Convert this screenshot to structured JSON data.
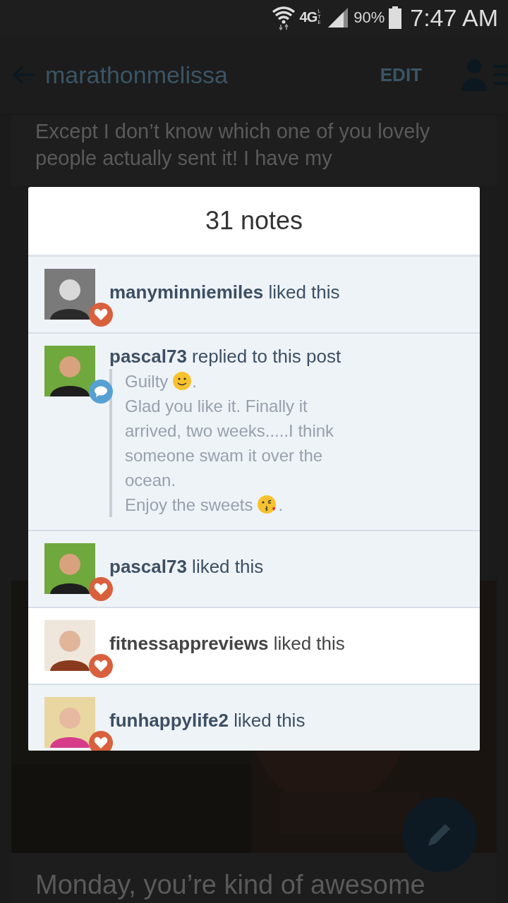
{
  "status_bar": {
    "network": "4G",
    "network_sub": "LTE",
    "battery": "90%",
    "time": "7:47 AM"
  },
  "app_bar": {
    "title": "marathonmelissa",
    "action": "EDIT"
  },
  "post": {
    "text": "Except I don’t know which one of you lovely people actually sent it! I have my"
  },
  "next_post": {
    "title": "Monday, you’re kind of awesome"
  },
  "notes_dialog": {
    "title": "31 notes",
    "notes": [
      {
        "kind": "like",
        "text": "**manyminniemiles** liked this",
        "highlighted": true
      },
      {
        "kind": "reply",
        "text": "**pascal73** replied to this post",
        "highlighted": true,
        "reply": [
          {
            "kind": "smile",
            "text": "Guilty",
            "after": "."
          },
          {
            "kind": "plain",
            "text": "Glad you like it. Finally it arrived, two weeks.....I think someone swam it over the ocean."
          },
          {
            "kind": "kiss",
            "text": "Enjoy the sweets",
            "after": "."
          }
        ]
      },
      {
        "kind": "like",
        "text": "**pascal73** liked this",
        "highlighted": true
      },
      {
        "kind": "like",
        "text": "**fitnessappreviews** liked this",
        "highlighted": false
      },
      {
        "kind": "like",
        "text": "**funhappylife2** liked this",
        "highlighted": true
      }
    ]
  }
}
